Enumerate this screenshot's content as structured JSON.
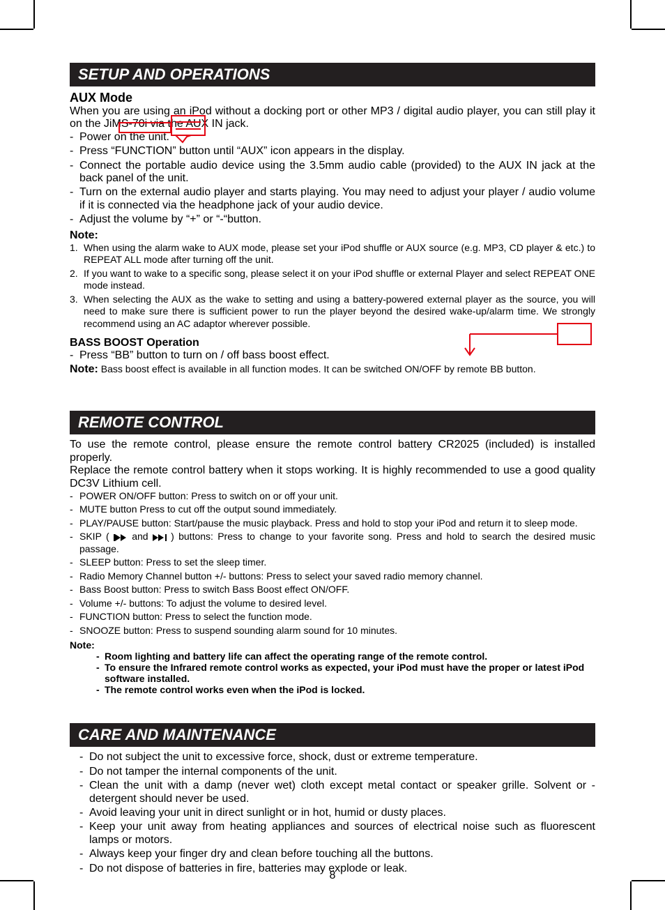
{
  "pageNumber": "8",
  "sections": {
    "setup": {
      "title": "SETUP AND OPERATIONS",
      "aux": {
        "heading": "AUX Mode",
        "intro": "When you are using an iPod without a docking port or other MP3 / digital audio player, you can still play it on the JiMS-70i via the AUX IN jack.",
        "items": [
          "Power on the unit.",
          "Press “FUNCTION” button until “AUX” icon appears in the display.",
          "Connect the portable audio device using the 3.5mm audio cable (provided) to the AUX IN jack at the back panel of the unit.",
          "Turn on the external audio player and starts playing. You may need to adjust your player / audio volume if it is connected via the headphone jack of your audio device.",
          "Adjust the volume by “+” or “-“button."
        ],
        "noteLabel": "Note:",
        "notes": [
          "When using the alarm wake to AUX mode, please set your iPod shuffle or AUX source (e.g. MP3, CD player & etc.) to REPEAT ALL mode after turning off the unit.",
          "If you want to wake to a specific song, please select it on your iPod shuffle or external Player and select REPEAT ONE mode instead.",
          "When selecting the AUX as the wake to setting and using a battery-powered external player as the source, you will need to make sure there is sufficient power to run the player beyond the desired wake-up/alarm time. We strongly recommend using an AC adaptor wherever possible."
        ]
      },
      "bass": {
        "heading": "BASS BOOST Operation",
        "item": "Press “BB” button to turn on / off bass boost effect.",
        "noteLabel": "Note:",
        "noteText": " Bass boost effect is available in all function modes. It can be switched ON/OFF by remote BB button."
      }
    },
    "remote": {
      "title": "REMOTE CONTROL",
      "intro1": "To use the remote control, please ensure the remote control battery CR2025 (included) is installed properly.",
      "intro2": "Replace the remote control battery when it stops working. It is highly recommended to use a good quality DC3V Lithium cell.",
      "items": [
        "POWER ON/OFF button: Press to switch on or off  your unit.",
        "MUTE button Press to cut off the output sound immediately.",
        "PLAY/PAUSE button: Start/pause the music playback. Press and hold to stop your iPod and return it to sleep mode.",
        "__SKIP__",
        "SLEEP button: Press to set the sleep timer.",
        "Radio Memory Channel button +/- buttons: Press to select your saved radio memory channel.",
        "Bass Boost button: Press to switch Bass Boost effect ON/OFF.",
        "Volume +/- buttons: To adjust the volume to desired level.",
        "FUNCTION button: Press to select the function mode.",
        "SNOOZE button: Press to suspend sounding alarm sound for 10 minutes."
      ],
      "skip": {
        "prefix": "SKIP ( ",
        "middle": " and ",
        "suffix": " ) buttons: Press to change to your favorite song. Press and hold to search the desired music passage."
      },
      "noteLabel": "Note:",
      "notes": [
        "Room lighting and battery life can affect the operating range of the remote control.",
        "To ensure the Infrared remote control works as expected, your iPod must have the proper or latest iPod software installed.",
        "The remote control works even when the iPod is locked."
      ]
    },
    "care": {
      "title": "CARE AND MAINTENANCE",
      "items": [
        "Do not subject the unit to excessive force, shock, dust or extreme temperature.",
        "Do not tamper the internal components of the unit.",
        "Clean the unit with a damp (never wet) cloth except metal contact or speaker grille. Solvent or - detergent should never be used.",
        "Avoid leaving your unit in direct sunlight or in hot, humid or dusty places.",
        "Keep your unit away from heating appliances and sources of electrical noise such as fluorescent lamps or motors.",
        "Always keep your finger dry and clean before touching all the buttons.",
        "Do not dispose of batteries in fire, batteries may explode or leak."
      ]
    }
  }
}
